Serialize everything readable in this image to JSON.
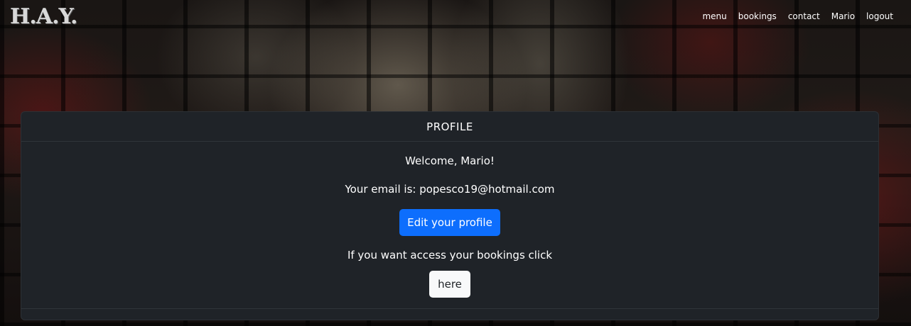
{
  "navbar": {
    "brand": "H.A.Y.",
    "links": [
      "menu",
      "bookings",
      "contact",
      "Mario",
      "logout"
    ]
  },
  "profile": {
    "title": "PROFILE",
    "welcome": "Welcome, Mario!",
    "email_text": "Your email is: popesco19@hotmail.com",
    "edit_button": "Edit your profile",
    "bookings_text": "If you want access your bookings click",
    "here_button": "here"
  },
  "colors": {
    "card_bg": "#1f2328",
    "primary_button": "#0d6efd",
    "light_button": "#f8f9fa"
  }
}
